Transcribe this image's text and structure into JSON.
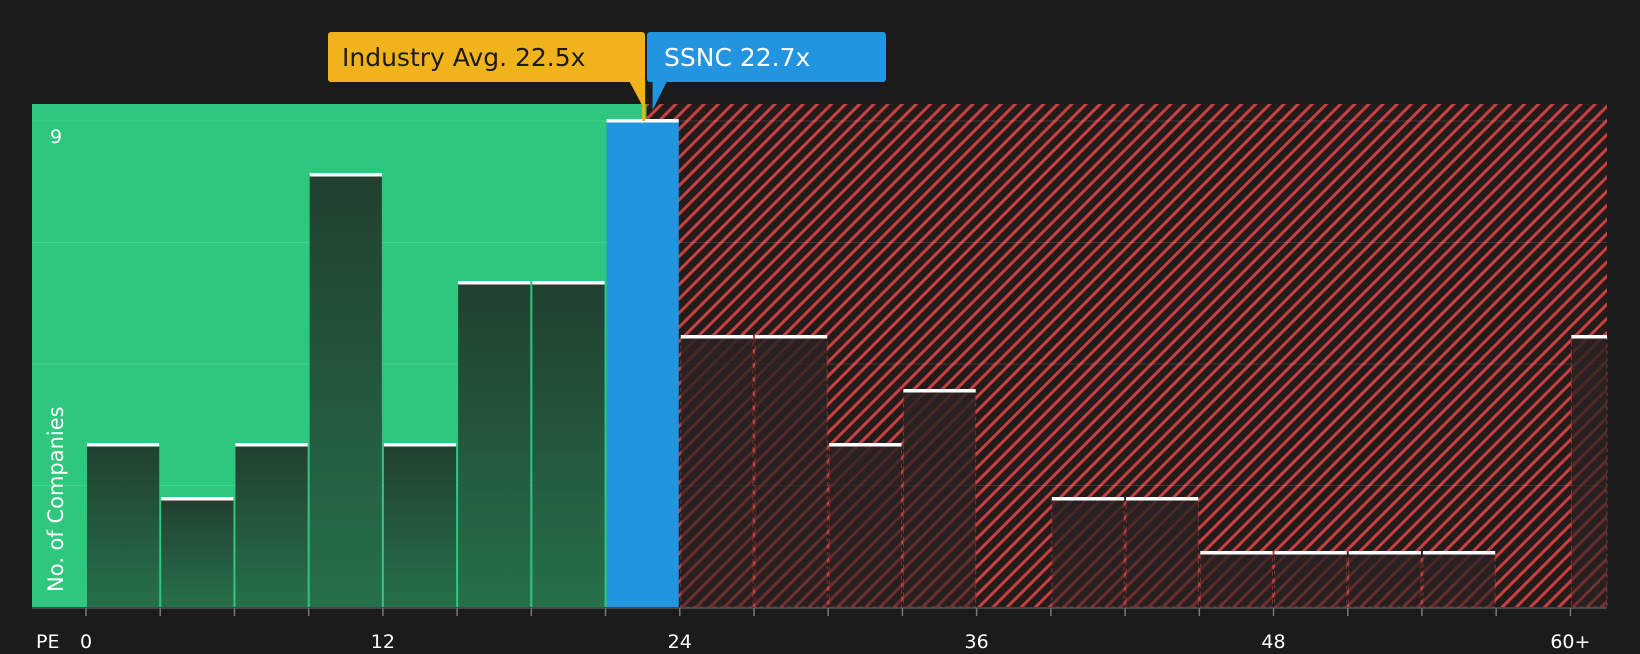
{
  "chart_data": {
    "type": "bar",
    "x_axis_label": "PE",
    "y_axis_label": "No. of Companies",
    "y_max_label": "9",
    "ylim": [
      0,
      9
    ],
    "x_tick_labels": [
      "0",
      "12",
      "24",
      "36",
      "48",
      "60+"
    ],
    "x_tick_values": [
      0,
      12,
      24,
      36,
      48,
      60
    ],
    "bin_width": 3,
    "bins": [
      {
        "start": 0,
        "value": 3
      },
      {
        "start": 3,
        "value": 2
      },
      {
        "start": 6,
        "value": 3
      },
      {
        "start": 9,
        "value": 8
      },
      {
        "start": 12,
        "value": 3
      },
      {
        "start": 15,
        "value": 6
      },
      {
        "start": 18,
        "value": 6
      },
      {
        "start": 21,
        "value": 9,
        "highlight": true
      },
      {
        "start": 24,
        "value": 5
      },
      {
        "start": 27,
        "value": 5
      },
      {
        "start": 30,
        "value": 3
      },
      {
        "start": 33,
        "value": 4
      },
      {
        "start": 36,
        "value": 0
      },
      {
        "start": 39,
        "value": 2
      },
      {
        "start": 42,
        "value": 2
      },
      {
        "start": 45,
        "value": 1
      },
      {
        "start": 48,
        "value": 1
      },
      {
        "start": 51,
        "value": 1
      },
      {
        "start": 54,
        "value": 1
      },
      {
        "start": 57,
        "value": 0
      },
      {
        "start": 60,
        "value": 5
      }
    ],
    "industry_avg": {
      "label": "Industry Avg. 22.5x",
      "value": 22.5
    },
    "company": {
      "label": "SSNC 22.7x",
      "value": 22.7
    },
    "colors": {
      "background": "#1b1b1b",
      "undervalued_zone": "#2dc77e",
      "bar_dark": "#1f4a36",
      "highlight_bar": "#2394e0",
      "overvalued_hatch": "#d04343",
      "industry_label_bg": "#f0b31c",
      "company_label_bg": "#2394e0"
    }
  }
}
